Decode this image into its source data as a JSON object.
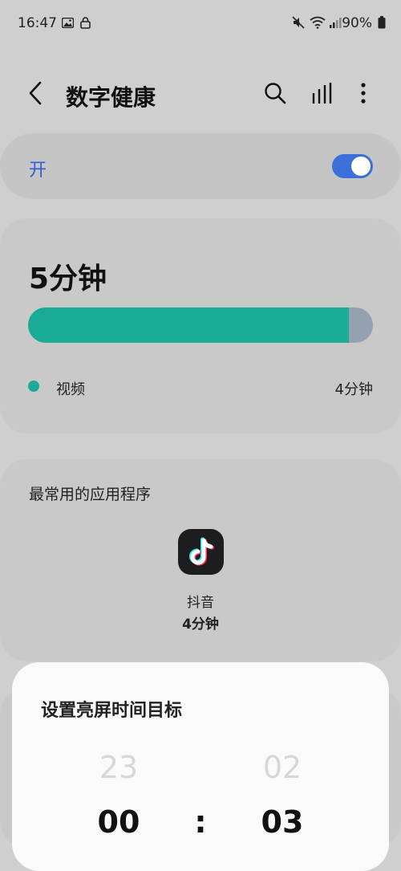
{
  "status_bar": {
    "time": "16:47",
    "battery": "90%",
    "icons": [
      "image-icon",
      "lock-icon",
      "mute-icon",
      "wifi-icon",
      "signal-icon",
      "battery-icon"
    ]
  },
  "header": {
    "title": "数字健康",
    "icons": [
      "back-icon",
      "search-icon",
      "chart-icon",
      "more-icon"
    ]
  },
  "toggle": {
    "label": "开",
    "state": "on",
    "accent": "#3d6fd8"
  },
  "usage": {
    "total": "5分钟",
    "bar_fill_fraction": 0.93,
    "fill_color": "#1aab96",
    "rest_color": "#95a0b1",
    "category": {
      "label": "视频",
      "value": "4分钟"
    }
  },
  "most_used": {
    "title": "最常用的应用程序",
    "app": {
      "name": "抖音",
      "time": "4分钟",
      "icon": "tiktok-icon"
    }
  },
  "sheet": {
    "title": "设置亮屏时间目标",
    "hours_prev": "23",
    "minutes_prev": "02",
    "hours_current": "00",
    "separator": ":",
    "minutes_current": "03"
  }
}
